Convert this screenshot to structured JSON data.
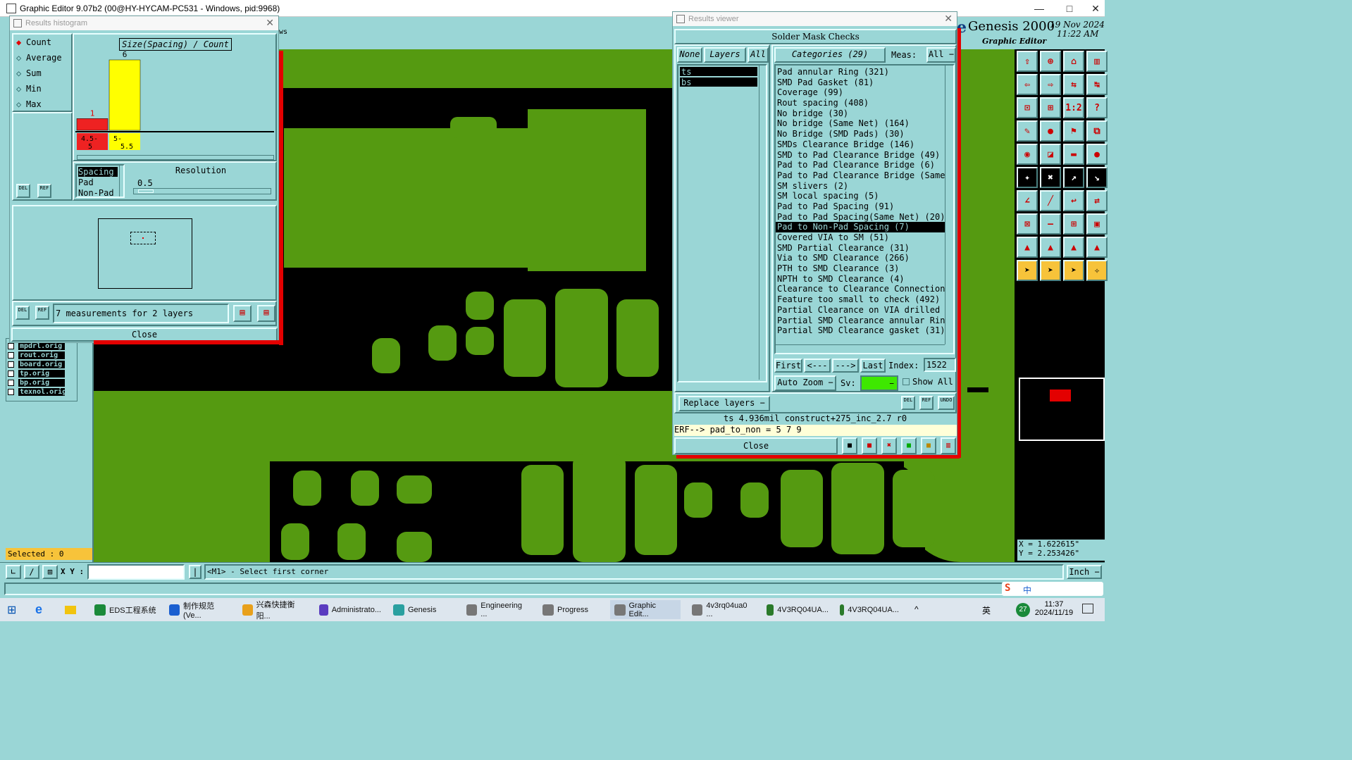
{
  "app": {
    "title": "Graphic Editor 9.07b2 (00@HY-HYCAM-PC531 - Windows, pid:9968)",
    "brand": "Genesis 2000",
    "brand_sub": "Graphic Editor",
    "date": "19 Nov 2024",
    "time": "11:22 AM",
    "partial_label": "ws"
  },
  "histogram": {
    "title": "Results histogram",
    "modes": [
      "Count",
      "Average",
      "Sum",
      "Min",
      "Max"
    ],
    "selected_mode": "Count",
    "chart_title": "Size(Spacing) / Count",
    "chart_data": {
      "type": "bar",
      "categories": [
        "4.5-5",
        "5-5.5"
      ],
      "values": [
        1,
        6
      ],
      "colors": [
        "#ee2222",
        "#ffff00"
      ]
    },
    "attrs": [
      "Spacing",
      "Pad",
      "Non-Pad"
    ],
    "selected_attr": "Spacing",
    "resolution_label": "Resolution",
    "resolution_value": "0.5",
    "del": "DEL",
    "ref": "REF",
    "summary": "7 measurements for 2 layers",
    "close": "Close"
  },
  "results": {
    "title": "Results viewer",
    "header": "Solder Mask Checks",
    "none": "None",
    "layers_label": "Layers",
    "all": "All",
    "categories_label": "Categories (29)",
    "meas_label": "Meas:",
    "meas_value": "All",
    "layers": [
      "ts",
      "bs"
    ],
    "categories": [
      "Pad annular Ring (321)",
      "SMD Pad Gasket (81)",
      "Coverage (99)",
      "Rout spacing (408)",
      "No bridge (30)",
      "No bridge (Same Net) (164)",
      "No Bridge (SMD Pads) (30)",
      "SMDs Clearance Bridge (146)",
      "SMD to Pad Clearance Bridge (49)",
      "Pad to Pad Clearance Bridge (6)",
      "Pad to Pad Clearance Bridge (Same",
      "SM slivers (2)",
      "SM local spacing (5)",
      "Pad to Pad Spacing (91)",
      "Pad to Pad Spacing(Same Net) (20)",
      "Pad to Non-Pad Spacing (7)",
      "Covered VIA to SM (51)",
      "SMD Partial Clearance (31)",
      "Via to SMD Clearance (266)",
      "PTH to SMD Clearance (3)",
      "NPTH to SMD Clearance (4)",
      "Clearance to Clearance Connection",
      "Feature too small to check (492)",
      "Partial Clearance on VIA drilled",
      "Partial SMD Clearance annular Rin",
      "Partial SMD Clearance gasket (31)"
    ],
    "selected_category": "Pad to Non-Pad Spacing (7)",
    "first": "First",
    "prev": "<---",
    "next": "--->",
    "last": "Last",
    "index_label": "Index:",
    "index_value": "1522",
    "auto_zoom": "Auto Zoom",
    "sv_label": "Sv:",
    "show_all": "Show All",
    "replace_layers": "Replace layers",
    "del": "DEL",
    "ref": "REF",
    "undo": "UNDO",
    "status": "ts 4.936mil  construct+275_inc_2.7  r0",
    "erf": "ERF--> pad_to_non = 5 7 9",
    "close": "Close"
  },
  "layers_list": [
    "mpdrl.orig",
    "rout.orig",
    "board.orig",
    "tp.orig",
    "bp.orig",
    "texnol.orig"
  ],
  "selected_count": "Selected : 0",
  "coords": {
    "x": "X = 1.622615\"",
    "y": "Y = 2.253426\""
  },
  "bottom": {
    "xy_label": "X Y :",
    "xy_value": "",
    "prompt": "<M1> - Select first corner",
    "units": "Inch"
  },
  "taskbar": {
    "items": [
      "EDS工程系统",
      "制作规范 (Ve...",
      "兴森快捷衡阳...",
      "Administrato...",
      "Genesis",
      "Engineering ...",
      "Progress",
      "Graphic Edit...",
      "4v3rq04ua0 ...",
      "4V3RQ04UA...",
      "4V3RQ04UA..."
    ],
    "clock_time": "11:37",
    "clock_date": "2024/11/19",
    "ime": "英",
    "notif": "27"
  }
}
